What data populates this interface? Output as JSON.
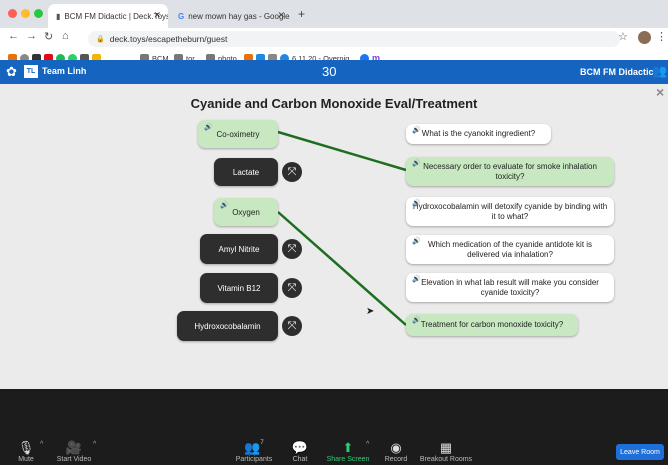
{
  "browser": {
    "tabs": [
      {
        "title": "BCM FM Didactic | Deck.Toys",
        "active": true
      },
      {
        "title": "new mown hay gas - Google S",
        "active": false
      }
    ],
    "new_tab": "+",
    "url": "deck.toys/escapetheburn/guest",
    "bookmarks": [
      "BCM",
      "tor",
      "photo",
      "6.11.20 - Overnig..."
    ]
  },
  "app": {
    "team": "Team Linh",
    "team_badge": "TL",
    "timer": "30",
    "deck_title": "BCM FM Didactic"
  },
  "activity": {
    "title": "Cyanide and Carbon Monoxide Eval/Treatment",
    "close": "×",
    "answers": [
      {
        "label": "Co-oximetry",
        "style": "green"
      },
      {
        "label": "Lactate",
        "style": "dark"
      },
      {
        "label": "Oxygen",
        "style": "green"
      },
      {
        "label": "Amyl Nitrite",
        "style": "dark"
      },
      {
        "label": "Vitamin B12",
        "style": "dark"
      },
      {
        "label": "Hydroxocobalamin",
        "style": "dark"
      }
    ],
    "questions": [
      {
        "text": "What is the cyanokit ingredient?",
        "style": "white"
      },
      {
        "text": "Necessary order to evaluate for smoke inhalation toxicity?",
        "style": "green"
      },
      {
        "text": "Hydroxocobalamin will detoxify cyanide by binding with it to what?",
        "style": "white"
      },
      {
        "text": "Which medication of the cyanide antidote kit is delivered via inhalation?",
        "style": "white"
      },
      {
        "text": "Elevation in what lab result will make you consider cyanide toxicity?",
        "style": "white"
      },
      {
        "text": "Treatment for carbon monoxide toxicity?",
        "style": "green"
      }
    ],
    "connector_color": "#1f6e1f"
  },
  "zoom": {
    "tools": [
      {
        "label": "Mute",
        "icon": "microphone-icon"
      },
      {
        "label": "Start Video",
        "icon": "video-off-icon"
      },
      {
        "label": "Participants",
        "icon": "participants-icon",
        "count": "7"
      },
      {
        "label": "Chat",
        "icon": "chat-icon"
      },
      {
        "label": "Share Screen",
        "icon": "share-screen-icon"
      },
      {
        "label": "Record",
        "icon": "record-icon"
      },
      {
        "label": "Breakout Rooms",
        "icon": "breakout-rooms-icon"
      }
    ],
    "leave": "Leave Room"
  }
}
